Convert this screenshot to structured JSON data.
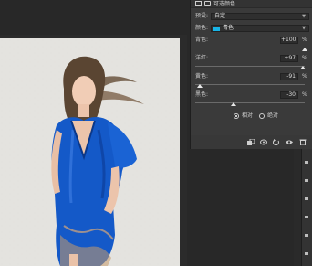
{
  "colors": {
    "accent_swatch": "#18b4e6",
    "panel_bg": "#3a3a3a",
    "canvas_bg": "#282828"
  },
  "panel": {
    "title": "可选颜色",
    "icons": [
      "adjustment-layer-icon",
      "mask-icon"
    ],
    "preset": {
      "label": "预设:",
      "value": "自定"
    },
    "colors": {
      "label": "颜色:",
      "value": "青色"
    },
    "sliders": [
      {
        "label": "青色:",
        "value": "+100",
        "unit": "%",
        "level": 1.0
      },
      {
        "label": "洋红:",
        "value": "+97",
        "unit": "%",
        "level": 0.985
      },
      {
        "label": "黄色:",
        "value": "-91",
        "unit": "%",
        "level": 0.045
      },
      {
        "label": "黑色:",
        "value": "-30",
        "unit": "%",
        "level": 0.35
      }
    ],
    "method": {
      "relative_label": "相对",
      "absolute_label": "绝对",
      "selected": "relative"
    },
    "footer_icons": [
      "clip-to-layer-icon",
      "view-previous-icon",
      "reset-icon",
      "visibility-icon",
      "delete-icon"
    ]
  }
}
